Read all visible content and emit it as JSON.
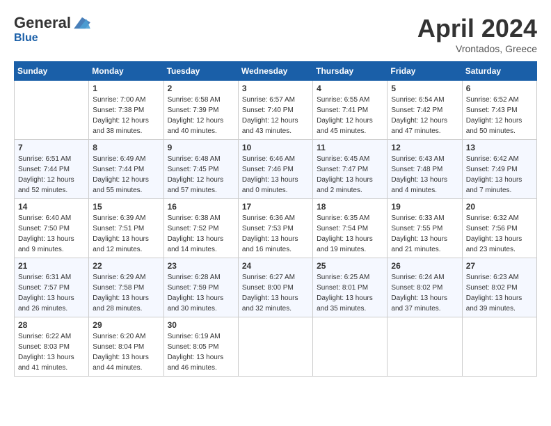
{
  "header": {
    "logo_general": "General",
    "logo_blue": "Blue",
    "month_title": "April 2024",
    "location": "Vrontados, Greece"
  },
  "calendar": {
    "days_of_week": [
      "Sunday",
      "Monday",
      "Tuesday",
      "Wednesday",
      "Thursday",
      "Friday",
      "Saturday"
    ],
    "weeks": [
      [
        {
          "day": "",
          "sunrise": "",
          "sunset": "",
          "daylight": ""
        },
        {
          "day": "1",
          "sunrise": "Sunrise: 7:00 AM",
          "sunset": "Sunset: 7:38 PM",
          "daylight": "Daylight: 12 hours and 38 minutes."
        },
        {
          "day": "2",
          "sunrise": "Sunrise: 6:58 AM",
          "sunset": "Sunset: 7:39 PM",
          "daylight": "Daylight: 12 hours and 40 minutes."
        },
        {
          "day": "3",
          "sunrise": "Sunrise: 6:57 AM",
          "sunset": "Sunset: 7:40 PM",
          "daylight": "Daylight: 12 hours and 43 minutes."
        },
        {
          "day": "4",
          "sunrise": "Sunrise: 6:55 AM",
          "sunset": "Sunset: 7:41 PM",
          "daylight": "Daylight: 12 hours and 45 minutes."
        },
        {
          "day": "5",
          "sunrise": "Sunrise: 6:54 AM",
          "sunset": "Sunset: 7:42 PM",
          "daylight": "Daylight: 12 hours and 47 minutes."
        },
        {
          "day": "6",
          "sunrise": "Sunrise: 6:52 AM",
          "sunset": "Sunset: 7:43 PM",
          "daylight": "Daylight: 12 hours and 50 minutes."
        }
      ],
      [
        {
          "day": "7",
          "sunrise": "Sunrise: 6:51 AM",
          "sunset": "Sunset: 7:44 PM",
          "daylight": "Daylight: 12 hours and 52 minutes."
        },
        {
          "day": "8",
          "sunrise": "Sunrise: 6:49 AM",
          "sunset": "Sunset: 7:44 PM",
          "daylight": "Daylight: 12 hours and 55 minutes."
        },
        {
          "day": "9",
          "sunrise": "Sunrise: 6:48 AM",
          "sunset": "Sunset: 7:45 PM",
          "daylight": "Daylight: 12 hours and 57 minutes."
        },
        {
          "day": "10",
          "sunrise": "Sunrise: 6:46 AM",
          "sunset": "Sunset: 7:46 PM",
          "daylight": "Daylight: 13 hours and 0 minutes."
        },
        {
          "day": "11",
          "sunrise": "Sunrise: 6:45 AM",
          "sunset": "Sunset: 7:47 PM",
          "daylight": "Daylight: 13 hours and 2 minutes."
        },
        {
          "day": "12",
          "sunrise": "Sunrise: 6:43 AM",
          "sunset": "Sunset: 7:48 PM",
          "daylight": "Daylight: 13 hours and 4 minutes."
        },
        {
          "day": "13",
          "sunrise": "Sunrise: 6:42 AM",
          "sunset": "Sunset: 7:49 PM",
          "daylight": "Daylight: 13 hours and 7 minutes."
        }
      ],
      [
        {
          "day": "14",
          "sunrise": "Sunrise: 6:40 AM",
          "sunset": "Sunset: 7:50 PM",
          "daylight": "Daylight: 13 hours and 9 minutes."
        },
        {
          "day": "15",
          "sunrise": "Sunrise: 6:39 AM",
          "sunset": "Sunset: 7:51 PM",
          "daylight": "Daylight: 13 hours and 12 minutes."
        },
        {
          "day": "16",
          "sunrise": "Sunrise: 6:38 AM",
          "sunset": "Sunset: 7:52 PM",
          "daylight": "Daylight: 13 hours and 14 minutes."
        },
        {
          "day": "17",
          "sunrise": "Sunrise: 6:36 AM",
          "sunset": "Sunset: 7:53 PM",
          "daylight": "Daylight: 13 hours and 16 minutes."
        },
        {
          "day": "18",
          "sunrise": "Sunrise: 6:35 AM",
          "sunset": "Sunset: 7:54 PM",
          "daylight": "Daylight: 13 hours and 19 minutes."
        },
        {
          "day": "19",
          "sunrise": "Sunrise: 6:33 AM",
          "sunset": "Sunset: 7:55 PM",
          "daylight": "Daylight: 13 hours and 21 minutes."
        },
        {
          "day": "20",
          "sunrise": "Sunrise: 6:32 AM",
          "sunset": "Sunset: 7:56 PM",
          "daylight": "Daylight: 13 hours and 23 minutes."
        }
      ],
      [
        {
          "day": "21",
          "sunrise": "Sunrise: 6:31 AM",
          "sunset": "Sunset: 7:57 PM",
          "daylight": "Daylight: 13 hours and 26 minutes."
        },
        {
          "day": "22",
          "sunrise": "Sunrise: 6:29 AM",
          "sunset": "Sunset: 7:58 PM",
          "daylight": "Daylight: 13 hours and 28 minutes."
        },
        {
          "day": "23",
          "sunrise": "Sunrise: 6:28 AM",
          "sunset": "Sunset: 7:59 PM",
          "daylight": "Daylight: 13 hours and 30 minutes."
        },
        {
          "day": "24",
          "sunrise": "Sunrise: 6:27 AM",
          "sunset": "Sunset: 8:00 PM",
          "daylight": "Daylight: 13 hours and 32 minutes."
        },
        {
          "day": "25",
          "sunrise": "Sunrise: 6:25 AM",
          "sunset": "Sunset: 8:01 PM",
          "daylight": "Daylight: 13 hours and 35 minutes."
        },
        {
          "day": "26",
          "sunrise": "Sunrise: 6:24 AM",
          "sunset": "Sunset: 8:02 PM",
          "daylight": "Daylight: 13 hours and 37 minutes."
        },
        {
          "day": "27",
          "sunrise": "Sunrise: 6:23 AM",
          "sunset": "Sunset: 8:02 PM",
          "daylight": "Daylight: 13 hours and 39 minutes."
        }
      ],
      [
        {
          "day": "28",
          "sunrise": "Sunrise: 6:22 AM",
          "sunset": "Sunset: 8:03 PM",
          "daylight": "Daylight: 13 hours and 41 minutes."
        },
        {
          "day": "29",
          "sunrise": "Sunrise: 6:20 AM",
          "sunset": "Sunset: 8:04 PM",
          "daylight": "Daylight: 13 hours and 44 minutes."
        },
        {
          "day": "30",
          "sunrise": "Sunrise: 6:19 AM",
          "sunset": "Sunset: 8:05 PM",
          "daylight": "Daylight: 13 hours and 46 minutes."
        },
        {
          "day": "",
          "sunrise": "",
          "sunset": "",
          "daylight": ""
        },
        {
          "day": "",
          "sunrise": "",
          "sunset": "",
          "daylight": ""
        },
        {
          "day": "",
          "sunrise": "",
          "sunset": "",
          "daylight": ""
        },
        {
          "day": "",
          "sunrise": "",
          "sunset": "",
          "daylight": ""
        }
      ]
    ]
  }
}
